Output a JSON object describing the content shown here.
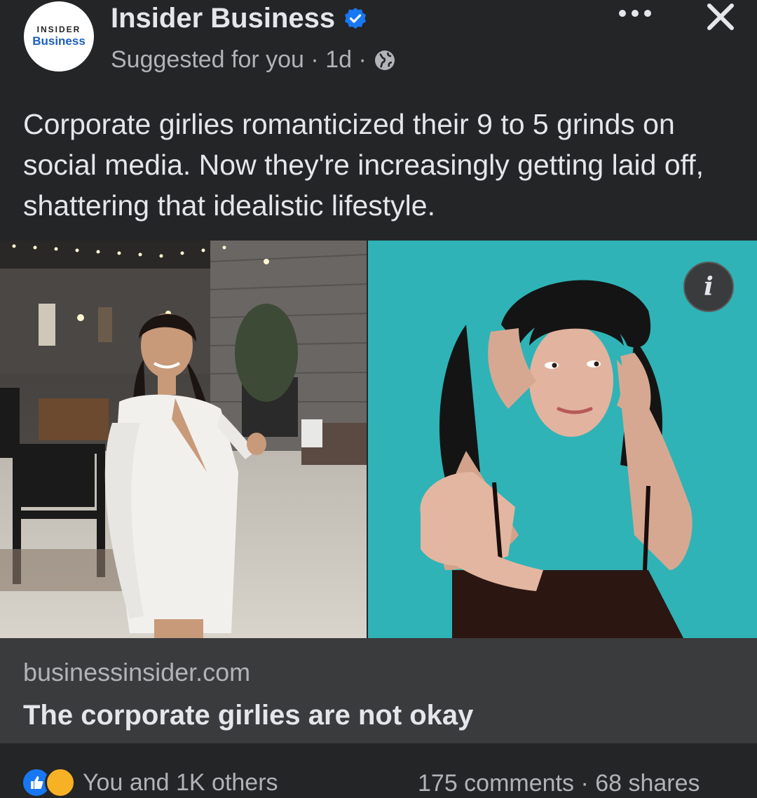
{
  "post": {
    "avatar_line1": "INSIDER",
    "avatar_line2": "Business",
    "page_name": "Insider Business",
    "suggested": "Suggested for you",
    "time": "1d",
    "text": "Corporate girlies romanticized their 9 to 5 grinds on social media. Now they're increasingly getting laid off, shattering that idealistic lifestyle.",
    "info_label": "i"
  },
  "link": {
    "domain": "businessinsider.com",
    "title": "The corporate girlies are not okay"
  },
  "footer": {
    "reactions_text": "You and 1K others",
    "counts_text": "175 comments · 68 shares"
  },
  "colors": {
    "background": "#242526",
    "link_card": "#3a3b3c",
    "verified": "#1877f2",
    "teal_backdrop": "#2fb3b6"
  },
  "icons": [
    "verified-badge-icon",
    "globe-icon",
    "more-options-icon",
    "close-icon",
    "info-icon",
    "like-reaction-icon",
    "haha-reaction-icon"
  ]
}
